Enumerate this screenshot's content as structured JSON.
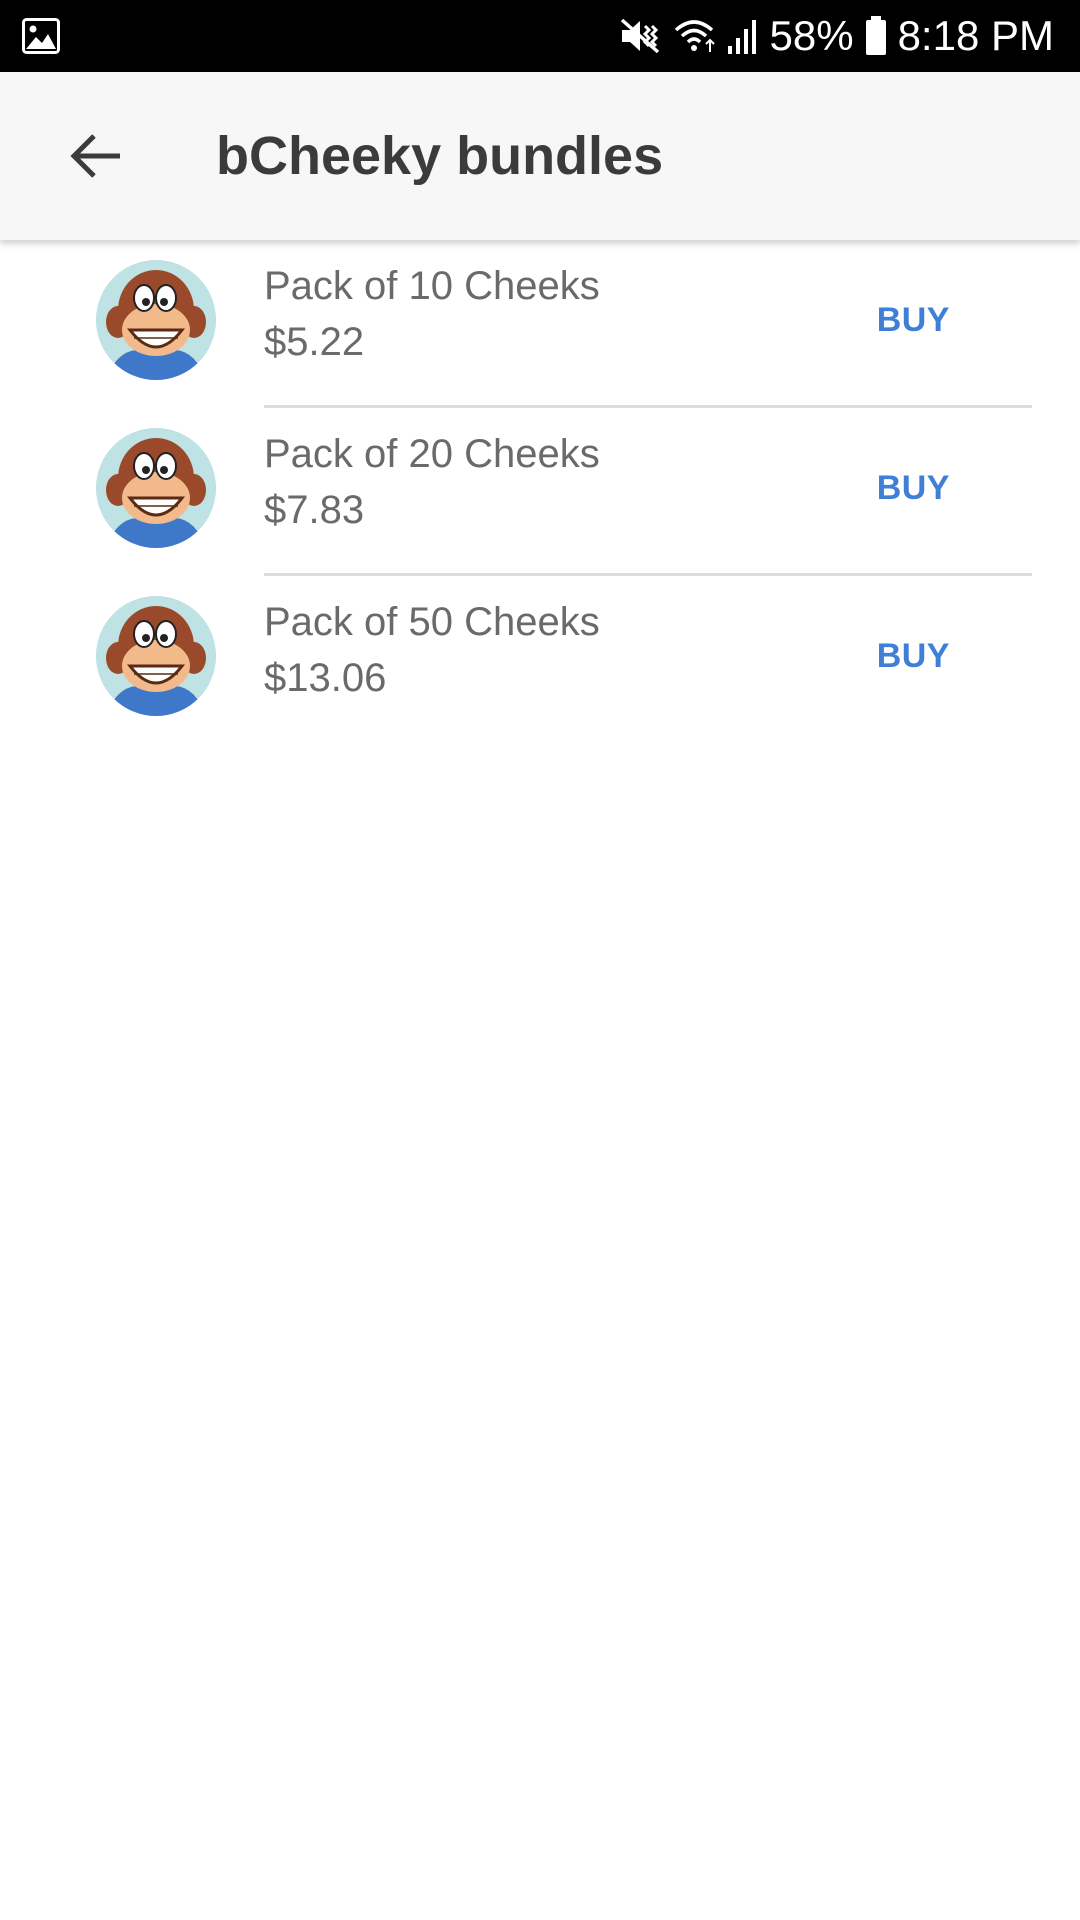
{
  "status_bar": {
    "battery": "58%",
    "time": "8:18 PM"
  },
  "app_bar": {
    "title": "bCheeky bundles"
  },
  "bundles": [
    {
      "name": "Pack of 10 Cheeks",
      "price": "$5.22",
      "action": "BUY"
    },
    {
      "name": "Pack of 20 Cheeks",
      "price": "$7.83",
      "action": "BUY"
    },
    {
      "name": "Pack of 50 Cheeks",
      "price": "$13.06",
      "action": "BUY"
    }
  ],
  "colors": {
    "status_bar_bg": "#000000",
    "app_bar_bg": "#f7f7f7",
    "title_text": "#3b3b3b",
    "secondary_text": "#6a6a6a",
    "accent": "#3f7fd6",
    "divider": "#dcdcdc"
  },
  "icons": {
    "status_left": "image-notification-icon",
    "status_right": [
      "mute-vibrate-icon",
      "wifi-icon",
      "signal-icon",
      "battery-icon"
    ],
    "back": "back-arrow-icon",
    "bundle_avatar": "monkey-mascot-avatar"
  }
}
